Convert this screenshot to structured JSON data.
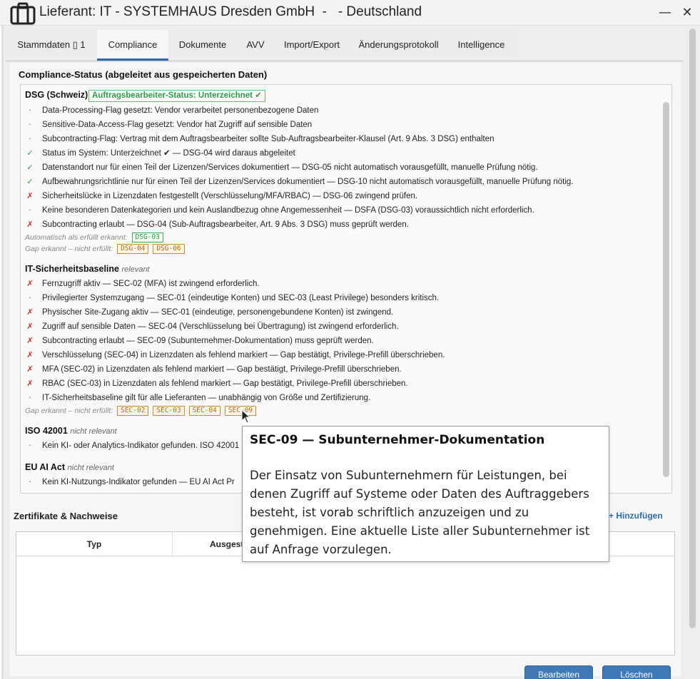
{
  "window": {
    "title": "Lieferant: IT - SYSTEMHAUS Dresden GmbH  -   - Deutschland",
    "minimize_glyph": "—",
    "close_glyph": "✕"
  },
  "tabs": [
    {
      "label": "Stammdaten  ▯ 1"
    },
    {
      "label": "Compliance"
    },
    {
      "label": "Dokumente"
    },
    {
      "label": "AVV"
    },
    {
      "label": "Import/Export"
    },
    {
      "label": "Änderungsprotokoll"
    },
    {
      "label": "Intelligence"
    }
  ],
  "compliance": {
    "heading": "Compliance-Status (abgeleitet aus gespeicherten Daten)",
    "dsg": {
      "title": "DSG (Schweiz)",
      "status": "Auftragsbearbeiter-Status: Unterzeichnet ✔",
      "rows": [
        {
          "symbol": "·",
          "kind": "dot",
          "text": "Data-Processing-Flag gesetzt: Vendor verarbeitet personenbezogene Daten"
        },
        {
          "symbol": "·",
          "kind": "dot",
          "text": "Sensitive-Data-Access-Flag gesetzt: Vendor hat Zugriff auf sensible Daten"
        },
        {
          "symbol": "·",
          "kind": "dot",
          "text": "Subcontracting-Flag: Vertrag mit dem Auftragsbearbeiter sollte Sub-Auftragsbearbeiter-Klausel (Art. 9 Abs. 3 DSG) enthalten"
        },
        {
          "symbol": "✓",
          "kind": "ok",
          "text": "Status im System: Unterzeichnet ✔ — DSG-04 wird daraus abgeleitet"
        },
        {
          "symbol": "✓",
          "kind": "ok",
          "text": "Datenstandort nur für einen Teil der Lizenzen/Services dokumentiert — DSG-05 nicht automatisch vorausgefüllt, manuelle Prüfung nötig."
        },
        {
          "symbol": "✓",
          "kind": "ok",
          "text": "Aufbewahrungsrichtlinie nur für einen Teil der Lizenzen/Services dokumentiert — DSG-10 nicht automatisch vorausgefüllt, manuelle Prüfung nötig."
        },
        {
          "symbol": "✗",
          "kind": "bad",
          "text": "Sicherheitslücke in Lizenzdaten festgestellt (Verschlüsselung/MFA/RBAC) — DSG-06 zwingend prüfen."
        },
        {
          "symbol": "·",
          "kind": "dot",
          "text": "Keine besonderen Datenkategorien und kein Auslandbezug ohne Angemessenheit — DSFA (DSG-03) voraussichtlich nicht erforderlich."
        },
        {
          "symbol": "✗",
          "kind": "bad",
          "text": "Subcontracting erlaubt — DSG-04 (Sub-Auftragsbearbeiter, Art. 9 Abs. 3 DSG) muss geprüft werden."
        }
      ],
      "auto_label": "Automatisch als erfüllt erkannt:",
      "auto_chips": [
        "DSG-03"
      ],
      "gap_label": "Gap erkannt – nicht erfüllt:",
      "gap_chips": [
        "DSG-04",
        "DSG-06"
      ]
    },
    "itsec": {
      "title": "IT-Sicherheitsbaseline",
      "tag": "relevant",
      "rows": [
        {
          "symbol": "✗",
          "kind": "bad",
          "text": "Fernzugriff aktiv — SEC-02 (MFA) ist zwingend erforderlich."
        },
        {
          "symbol": "·",
          "kind": "dot",
          "text": "Privilegierter Systemzugang — SEC-01 (eindeutige Konten) und SEC-03 (Least Privilege) besonders kritisch."
        },
        {
          "symbol": "✗",
          "kind": "bad",
          "text": "Physischer Site-Zugang aktiv — SEC-01 (eindeutige, personengebundene Konten) ist zwingend."
        },
        {
          "symbol": "✗",
          "kind": "bad",
          "text": "Zugriff auf sensible Daten — SEC-04 (Verschlüsselung bei Übertragung) ist zwingend erforderlich."
        },
        {
          "symbol": "✗",
          "kind": "bad",
          "text": "Subcontracting erlaubt — SEC-09 (Subunternehmer-Dokumentation) muss geprüft werden."
        },
        {
          "symbol": "✗",
          "kind": "bad",
          "text": "Verschlüsselung (SEC-04) in Lizenzdaten als fehlend markiert — Gap bestätigt, Privilege-Prefill überschrieben."
        },
        {
          "symbol": "✗",
          "kind": "bad",
          "text": "MFA (SEC-02) in Lizenzdaten als fehlend markiert — Gap bestätigt, Privilege-Prefill überschrieben."
        },
        {
          "symbol": "✗",
          "kind": "bad",
          "text": "RBAC (SEC-03) in Lizenzdaten als fehlend markiert — Gap bestätigt, Privilege-Prefill überschrieben."
        },
        {
          "symbol": "·",
          "kind": "dot",
          "text": "IT-Sicherheitsbaseline gilt für alle Lieferanten — unabhängig von Größe und Zertifizierung."
        }
      ],
      "gap_label": "Gap erkannt – nicht erfüllt:",
      "gap_chips": [
        "SEC-02",
        "SEC-03",
        "SEC-04",
        "SEC-09"
      ]
    },
    "iso": {
      "title": "ISO 42001",
      "tag": "nicht relevant",
      "rows": [
        {
          "symbol": "·",
          "kind": "dot",
          "text": "Kein KI- oder Analytics-Indikator gefunden. ISO 42001"
        }
      ]
    },
    "euai": {
      "title": "EU AI Act",
      "tag": "nicht relevant",
      "rows": [
        {
          "symbol": "·",
          "kind": "dot",
          "text": "Kein KI-Nutzungs-Indikator gefunden — EU AI Act Pr"
        }
      ]
    }
  },
  "certificates": {
    "heading": "Zertifikate & Nachweise",
    "add_label": "+ Hinzufügen",
    "columns": [
      "Typ",
      "Ausgest"
    ]
  },
  "buttons": {
    "edit": "Bearbeiten",
    "delete": "Löschen"
  },
  "tooltip": {
    "title": "SEC-09 — Subunternehmer-Dokumentation",
    "body": "Der Einsatz von Subunternehmern für Leistungen, bei denen Zugriff auf Systeme oder Daten des Auftraggebers besteht, ist vorab schriftlich anzuzeigen und zu genehmigen. Eine aktuelle Liste aller Subunternehmer ist auf Anfrage vorzulegen."
  },
  "colors": {
    "accent": "#2f6db5",
    "ok": "#2e9a47",
    "bad": "#cc2a2a",
    "gap": "#b8661a"
  }
}
